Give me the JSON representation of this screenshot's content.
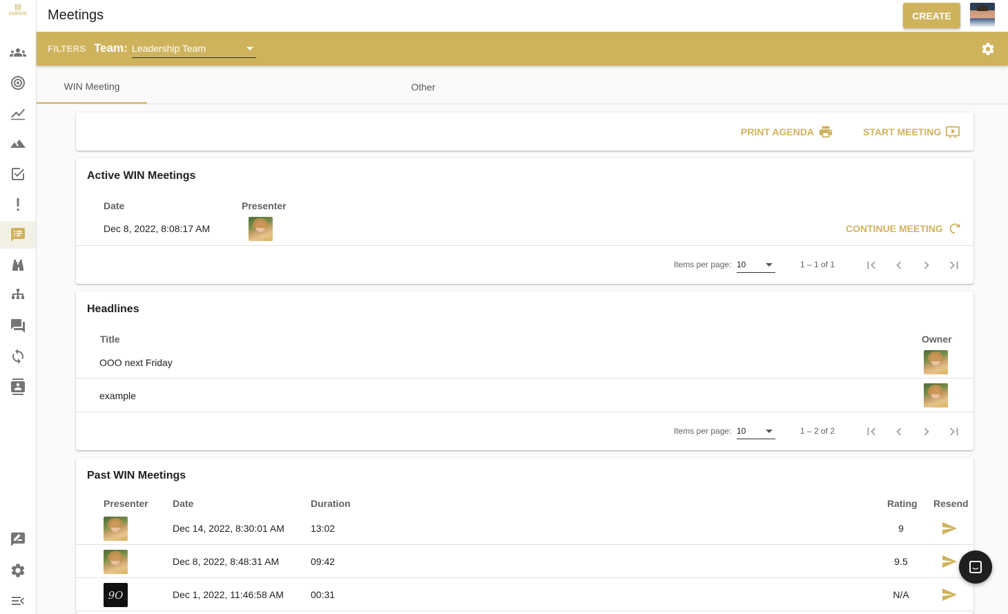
{
  "app": {
    "logo_text": "EMPIRE",
    "page_title": "Meetings",
    "create_label": "CREATE"
  },
  "sidebar": {
    "items": [
      {
        "icon": "people-icon"
      },
      {
        "icon": "target-icon"
      },
      {
        "icon": "line-chart-icon"
      },
      {
        "icon": "mountain-icon"
      },
      {
        "icon": "checkbox-icon"
      },
      {
        "icon": "exclamation-icon"
      },
      {
        "icon": "meetings-icon",
        "active": true
      },
      {
        "icon": "binoculars-icon"
      },
      {
        "icon": "org-chart-icon"
      },
      {
        "icon": "forum-icon"
      },
      {
        "icon": "sync-icon"
      },
      {
        "icon": "contact-card-icon"
      }
    ],
    "bottom": [
      {
        "icon": "feedback-icon"
      },
      {
        "icon": "settings-icon"
      },
      {
        "icon": "collapse-menu-icon"
      }
    ]
  },
  "filters": {
    "label": "FILTERS",
    "team_label": "Team:",
    "team_value": "Leadership Team"
  },
  "tabs": [
    {
      "label": "WIN Meeting",
      "active": true
    },
    {
      "label": "Other",
      "active": false
    }
  ],
  "actions": {
    "print_agenda": "PRINT AGENDA",
    "start_meeting": "START MEETING"
  },
  "active_meetings": {
    "title": "Active WIN Meetings",
    "columns": {
      "date": "Date",
      "presenter": "Presenter"
    },
    "rows": [
      {
        "date": "Dec 8, 2022, 8:08:17 AM",
        "presenter_avatar": "woman-avatar"
      }
    ],
    "continue_label": "CONTINUE MEETING",
    "paginator": {
      "items_label": "Items per page:",
      "page_size": "10",
      "range": "1 – 1 of 1"
    }
  },
  "headlines": {
    "title": "Headlines",
    "columns": {
      "title": "Title",
      "owner": "Owner"
    },
    "rows": [
      {
        "title": "OOO next Friday",
        "owner_avatar": "woman-avatar"
      },
      {
        "title": "example",
        "owner_avatar": "woman-avatar"
      }
    ],
    "paginator": {
      "items_label": "Items per page:",
      "page_size": "10",
      "range": "1 – 2 of 2"
    }
  },
  "past_meetings": {
    "title": "Past WIN Meetings",
    "columns": {
      "presenter": "Presenter",
      "date": "Date",
      "duration": "Duration",
      "rating": "Rating",
      "resend": "Resend"
    },
    "rows": [
      {
        "presenter_avatar": "woman-avatar",
        "date": "Dec 14, 2022, 8:30:01 AM",
        "duration": "13:02",
        "rating": "9"
      },
      {
        "presenter_avatar": "woman-avatar",
        "date": "Dec 8, 2022, 8:48:31 AM",
        "duration": "09:42",
        "rating": "9.5"
      },
      {
        "presenter_avatar": "logo-avatar",
        "avatar_text": "9O",
        "date": "Dec 1, 2022, 11:46:58 AM",
        "duration": "00:31",
        "rating": "N/A"
      }
    ]
  },
  "colors": {
    "accent": "#cfb35c",
    "fab": "#1f1f1f"
  }
}
